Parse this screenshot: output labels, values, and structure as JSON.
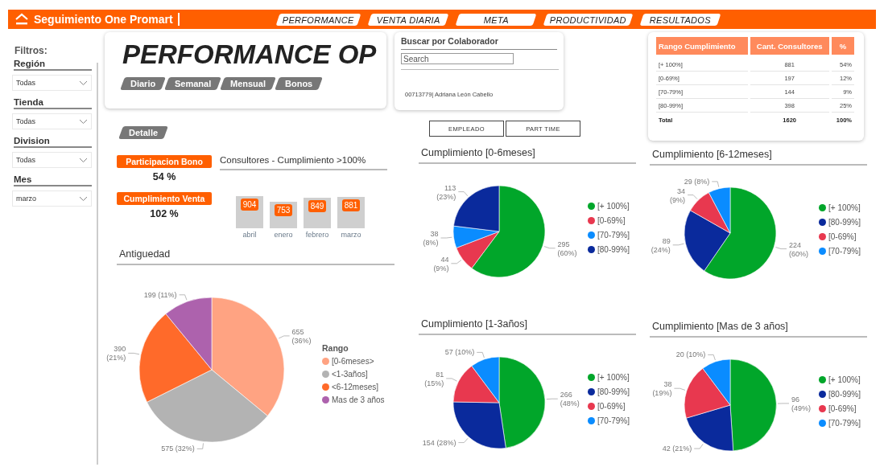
{
  "header": {
    "title": "Seguimiento One Promart",
    "nav": [
      "PERFORMANCE",
      "VENTA DIARIA",
      "META",
      "PRODUCTIVIDAD",
      "RESULTADOS"
    ]
  },
  "filters": {
    "title": "Filtros:",
    "items": [
      {
        "label": "Región",
        "value": "Todas"
      },
      {
        "label": "Tienda",
        "value": "Todas"
      },
      {
        "label": "Division",
        "value": "Todas"
      },
      {
        "label": "Mes",
        "value": "marzo"
      }
    ]
  },
  "title_card": {
    "title": "PERFORMANCE OP",
    "buttons": [
      "Diario",
      "Semanal",
      "Mensual",
      "Bonos"
    ]
  },
  "detail_button": "Detalle",
  "search_panel": {
    "title": "Buscar por Colaborador",
    "placeholder": "Search",
    "results": [
      "00713779| Adriana León Cabello"
    ]
  },
  "type_buttons": [
    "EMPLEADO",
    "PART TIME"
  ],
  "summary_table": {
    "columns": [
      "Rango Cumplimiento",
      "Cant. Consultores",
      "%"
    ],
    "rows": [
      [
        "[+ 100%]",
        "881",
        "54%"
      ],
      [
        "[0-69%]",
        "197",
        "12%"
      ],
      [
        "[70-79%]",
        "144",
        "9%"
      ],
      [
        "[80-99%]",
        "398",
        "25%"
      ]
    ],
    "total": [
      "Total",
      "1620",
      "100%"
    ]
  },
  "kpis": [
    {
      "label": "Participacion Bono",
      "value": "54 %"
    },
    {
      "label": "Cumplimiento Venta",
      "value": "102 %"
    }
  ],
  "consultants_chart": {
    "chart_data": {
      "type": "bar",
      "title": "Consultores - Cumplimiento >100%",
      "categories": [
        "abril",
        "enero",
        "febrero",
        "marzo"
      ],
      "values": [
        904,
        753,
        849,
        881
      ],
      "data_labels": true
    }
  },
  "seniority_chart": {
    "title": "Antiguedad",
    "chart_data": {
      "type": "pie",
      "categories": [
        "[0-6meses>",
        "<1-3años]",
        "<6-12meses]",
        "Mas de 3 años"
      ],
      "values": [
        655,
        575,
        390,
        199
      ],
      "colors": [
        "#ffa382",
        "#b3b3b3",
        "#ff6a2a",
        "#ad62ad"
      ],
      "value_labels": [
        "655 (36%)",
        "575 (32%)",
        "390 (21%)",
        "199 (11%)"
      ],
      "legend": "right"
    },
    "legend_title": "Rango"
  },
  "compliance_charts": [
    {
      "title": "Cumplimiento [0-6meses]",
      "chart_data": {
        "type": "pie",
        "categories": [
          "[+ 100%]",
          "[0-69%]",
          "[70-79%]",
          "[80-99%]"
        ],
        "values": [
          295,
          44,
          38,
          113
        ],
        "colors": [
          "#01a62a",
          "#e8384f",
          "#0a8cff",
          "#0a2a9c"
        ],
        "value_labels": [
          "295 (60%)",
          "44 (9%)",
          "38 (8%)",
          "113 (23%)"
        ],
        "legend": "right"
      }
    },
    {
      "title": "Cumplimiento [6-12meses]",
      "chart_data": {
        "type": "pie",
        "categories": [
          "[+ 100%]",
          "[80-99%]",
          "[0-69%]",
          "[70-79%]"
        ],
        "values": [
          224,
          89,
          34,
          29
        ],
        "colors": [
          "#01a62a",
          "#0a2a9c",
          "#e8384f",
          "#0a8cff"
        ],
        "value_labels": [
          "224 (60%)",
          "89 (24%)",
          "34 (9%)",
          "29 (8%)"
        ],
        "legend": "right"
      }
    },
    {
      "title": "Cumplimiento [1-3años]",
      "chart_data": {
        "type": "pie",
        "categories": [
          "[+ 100%]",
          "[80-99%]",
          "[0-69%]",
          "[70-79%]"
        ],
        "values": [
          266,
          154,
          81,
          57
        ],
        "colors": [
          "#01a62a",
          "#0a2a9c",
          "#e8384f",
          "#0a8cff"
        ],
        "value_labels": [
          "266 (48%)",
          "154 (28%)",
          "81 (15%)",
          "57 (10%)"
        ],
        "legend": "right"
      }
    },
    {
      "title": "Cumplimiento [Mas de 3 años]",
      "chart_data": {
        "type": "pie",
        "categories": [
          "[+ 100%]",
          "[80-99%]",
          "[0-69%]",
          "[70-79%]"
        ],
        "values": [
          96,
          42,
          38,
          20
        ],
        "colors": [
          "#01a62a",
          "#0a2a9c",
          "#e8384f",
          "#0a8cff"
        ],
        "value_labels": [
          "96 (49%)",
          "42 (21%)",
          "38 (19%)",
          "20 (10%)"
        ],
        "legend": "right"
      }
    }
  ]
}
